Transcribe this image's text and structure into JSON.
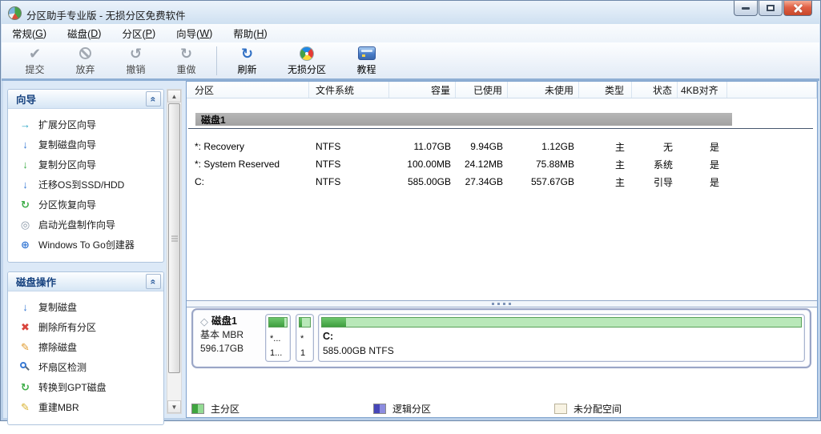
{
  "window": {
    "title": "分区助手专业版 - 无损分区免费软件"
  },
  "menu": {
    "items": [
      {
        "pre": "常规(",
        "key": "G",
        "post": ")"
      },
      {
        "pre": "磁盘(",
        "key": "D",
        "post": ")"
      },
      {
        "pre": "分区(",
        "key": "P",
        "post": ")"
      },
      {
        "pre": "向导(",
        "key": "W",
        "post": ")"
      },
      {
        "pre": "帮助(",
        "key": "H",
        "post": ")"
      }
    ]
  },
  "toolbar": {
    "buttons": [
      {
        "label": "提交",
        "icon": "commit-icon",
        "glyph": "✔",
        "enabled": false
      },
      {
        "label": "放弃",
        "icon": "discard-icon",
        "glyph": "",
        "enabled": false
      },
      {
        "label": "撤销",
        "icon": "undo-icon",
        "glyph": "↺",
        "enabled": false
      },
      {
        "label": "重做",
        "icon": "redo-icon",
        "glyph": "↻",
        "enabled": false
      },
      {
        "label": "刷新",
        "icon": "refresh-icon",
        "glyph": "↻",
        "enabled": true
      },
      {
        "label": "无损分区",
        "icon": "lossless-partition-icon",
        "glyph": "",
        "enabled": true
      },
      {
        "label": "教程",
        "icon": "tutorial-icon",
        "glyph": "",
        "enabled": true
      }
    ]
  },
  "sidebar": {
    "panels": [
      {
        "title": "向导",
        "items": [
          {
            "label": "扩展分区向导",
            "icon": "extend-partition-wizard-icon",
            "glyph": "→"
          },
          {
            "label": "复制磁盘向导",
            "icon": "copy-disk-wizard-icon",
            "glyph": "↓"
          },
          {
            "label": "复制分区向导",
            "icon": "copy-partition-wizard-icon",
            "glyph": "↓"
          },
          {
            "label": "迁移OS到SSD/HDD",
            "icon": "migrate-os-icon",
            "glyph": "↓"
          },
          {
            "label": "分区恢复向导",
            "icon": "partition-recovery-wizard-icon",
            "glyph": "↻"
          },
          {
            "label": "启动光盘制作向导",
            "icon": "bootable-cd-wizard-icon",
            "glyph": "◎"
          },
          {
            "label": "Windows To Go创建器",
            "icon": "windows-to-go-icon",
            "glyph": "⊕"
          }
        ]
      },
      {
        "title": "磁盘操作",
        "items": [
          {
            "label": "复制磁盘",
            "icon": "copy-disk-icon",
            "glyph": "↓"
          },
          {
            "label": "删除所有分区",
            "icon": "delete-all-partitions-icon",
            "glyph": "✖"
          },
          {
            "label": "擦除磁盘",
            "icon": "wipe-disk-icon",
            "glyph": "✎"
          },
          {
            "label": "坏扇区检测",
            "icon": "bad-sector-detect-icon",
            "glyph": ""
          },
          {
            "label": "转换到GPT磁盘",
            "icon": "convert-gpt-icon",
            "glyph": "↻"
          },
          {
            "label": "重建MBR",
            "icon": "rebuild-mbr-icon",
            "glyph": "✎"
          }
        ]
      }
    ]
  },
  "table": {
    "columns": [
      "分区",
      "文件系统",
      "容量",
      "已使用",
      "未使用",
      "类型",
      "状态",
      "4KB对齐"
    ],
    "group": "磁盘1",
    "rows": [
      {
        "partition": "*: Recovery",
        "fs": "NTFS",
        "capacity": "11.07GB",
        "used": "9.94GB",
        "unused": "1.12GB",
        "type": "主",
        "status": "无",
        "aligned": "是"
      },
      {
        "partition": "*: System Reserved",
        "fs": "NTFS",
        "capacity": "100.00MB",
        "used": "24.12MB",
        "unused": "75.88MB",
        "type": "主",
        "status": "系统",
        "aligned": "是"
      },
      {
        "partition": "C:",
        "fs": "NTFS",
        "capacity": "585.00GB",
        "used": "27.34GB",
        "unused": "557.67GB",
        "type": "主",
        "status": "引导",
        "aligned": "是"
      }
    ]
  },
  "disk_map": {
    "disk": {
      "name": "磁盘1",
      "scheme": "基本 MBR",
      "size": "596.17GB",
      "icon": "disk-icon",
      "glyph": "◇"
    },
    "partitions": [
      {
        "line1": "*...",
        "line2": "1...",
        "used_pct": 88
      },
      {
        "line1": "*",
        "line2": "1",
        "used_pct": 24
      },
      {
        "line1": "C:",
        "line2": "585.00GB NTFS",
        "used_pct": 5
      }
    ]
  },
  "legend": {
    "items": [
      {
        "label": "主分区",
        "swatch": {
          "dark": "#3fa53f",
          "light": "#94db94"
        }
      },
      {
        "label": "逻辑分区",
        "swatch": {
          "dark": "#4646b8",
          "light": "#8c8ce0"
        }
      },
      {
        "label": "未分配空间",
        "swatch": {
          "dark": "#f8f3e3",
          "light": "#f8f3e3"
        }
      }
    ]
  },
  "colors": {
    "primary_partition": "#3fa53f",
    "logical_partition": "#4646b8",
    "unallocated": "#f8f3e3",
    "panel_title_text": "#16427f",
    "toolbar_accent": "#2f6fc4"
  },
  "icons": {
    "collapse": "«",
    "scroll_up": "▲",
    "scroll_down": "▼"
  }
}
